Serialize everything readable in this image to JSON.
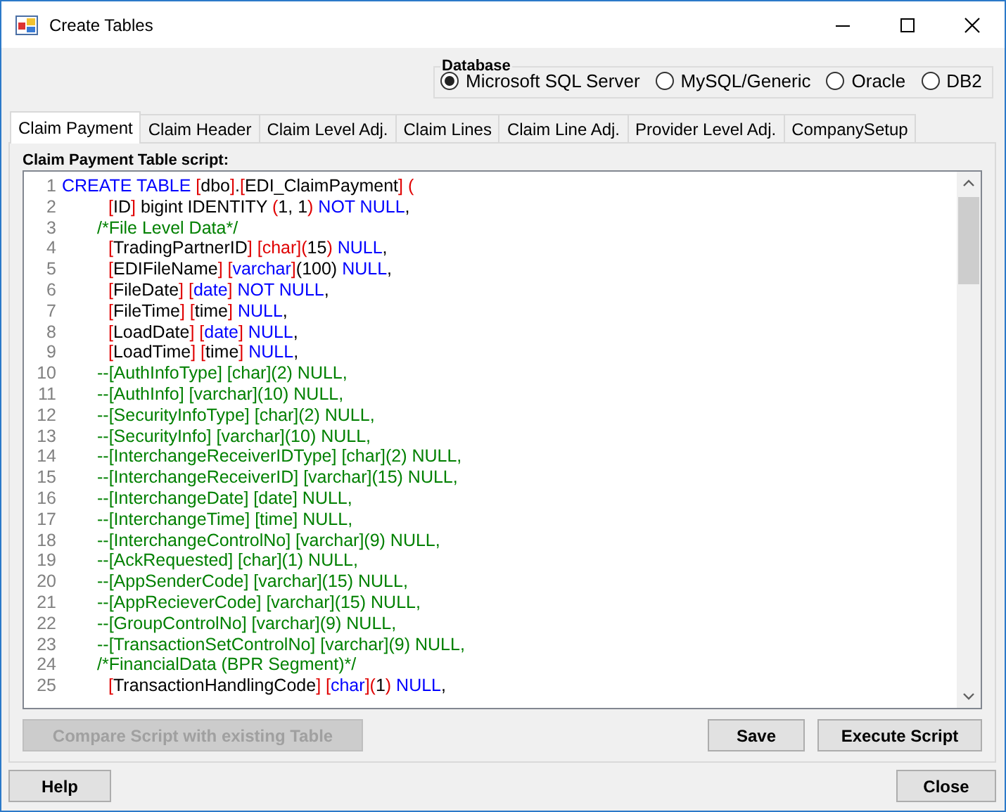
{
  "window": {
    "title": "Create Tables"
  },
  "database": {
    "label": "Database",
    "options": [
      {
        "label": "Microsoft SQL Server",
        "selected": true
      },
      {
        "label": "MySQL/Generic",
        "selected": false
      },
      {
        "label": "Oracle",
        "selected": false
      },
      {
        "label": "DB2",
        "selected": false
      }
    ]
  },
  "tabs": [
    {
      "label": "Claim Payment",
      "selected": true
    },
    {
      "label": "Claim Header",
      "selected": false
    },
    {
      "label": "Claim Level Adj.",
      "selected": false
    },
    {
      "label": "Claim Lines",
      "selected": false
    },
    {
      "label": "Claim Line Adj.",
      "selected": false
    },
    {
      "label": "Provider Level Adj.",
      "selected": false
    },
    {
      "label": "CompanySetup",
      "selected": false
    }
  ],
  "script_label": "Claim Payment Table script:",
  "editor": {
    "lines": [
      {
        "number": "1",
        "kind": "statement",
        "segments": [
          {
            "kind": "kw",
            "text": "CREATE TABLE "
          },
          {
            "kind": "br",
            "text": "["
          },
          {
            "kind": "tx",
            "text": "dbo"
          },
          {
            "kind": "br",
            "text": "]"
          },
          {
            "kind": "tx",
            "text": "."
          },
          {
            "kind": "br",
            "text": "["
          },
          {
            "kind": "tx",
            "text": "EDI_ClaimPayment"
          },
          {
            "kind": "br",
            "text": "] ("
          }
        ]
      },
      {
        "number": "2",
        "kind": "field",
        "segments": [
          {
            "kind": "br",
            "text": "["
          },
          {
            "kind": "tx",
            "text": "ID"
          },
          {
            "kind": "br",
            "text": "]"
          },
          {
            "kind": "tx",
            "text": " bigint IDENTITY "
          },
          {
            "kind": "br",
            "text": "("
          },
          {
            "kind": "tx",
            "text": "1, 1"
          },
          {
            "kind": "br",
            "text": ")"
          },
          {
            "kind": "kw",
            "text": " NOT NULL"
          },
          {
            "kind": "tx",
            "text": ","
          }
        ]
      },
      {
        "number": "3",
        "kind": "comment",
        "segments": [
          {
            "kind": "cm",
            "text": "/*File Level Data*/"
          }
        ]
      },
      {
        "number": "4",
        "kind": "field",
        "segments": [
          {
            "kind": "br",
            "text": "["
          },
          {
            "kind": "tx",
            "text": "TradingPartnerID"
          },
          {
            "kind": "br",
            "text": "] [char]("
          },
          {
            "kind": "tx",
            "text": "15"
          },
          {
            "kind": "br",
            "text": ")"
          },
          {
            "kind": "kw",
            "text": " NULL"
          },
          {
            "kind": "tx",
            "text": ","
          }
        ]
      },
      {
        "number": "5",
        "kind": "field",
        "segments": [
          {
            "kind": "br",
            "text": "["
          },
          {
            "kind": "tx",
            "text": "EDIFileName"
          },
          {
            "kind": "br",
            "text": "] ["
          },
          {
            "kind": "kw",
            "text": "varchar"
          },
          {
            "kind": "br",
            "text": "]"
          },
          {
            "kind": "tx",
            "text": "(100)"
          },
          {
            "kind": "kw",
            "text": " NULL"
          },
          {
            "kind": "tx",
            "text": ","
          }
        ]
      },
      {
        "number": "6",
        "kind": "field",
        "segments": [
          {
            "kind": "br",
            "text": "["
          },
          {
            "kind": "tx",
            "text": "FileDate"
          },
          {
            "kind": "br",
            "text": "] ["
          },
          {
            "kind": "kw",
            "text": "date"
          },
          {
            "kind": "br",
            "text": "]"
          },
          {
            "kind": "kw",
            "text": " NOT NULL"
          },
          {
            "kind": "tx",
            "text": ","
          }
        ]
      },
      {
        "number": "7",
        "kind": "field",
        "segments": [
          {
            "kind": "br",
            "text": "["
          },
          {
            "kind": "tx",
            "text": "FileTime"
          },
          {
            "kind": "br",
            "text": "] ["
          },
          {
            "kind": "tx",
            "text": "time"
          },
          {
            "kind": "br",
            "text": "]"
          },
          {
            "kind": "kw",
            "text": " NULL"
          },
          {
            "kind": "tx",
            "text": ","
          }
        ]
      },
      {
        "number": "8",
        "kind": "field",
        "segments": [
          {
            "kind": "br",
            "text": "["
          },
          {
            "kind": "tx",
            "text": "LoadDate"
          },
          {
            "kind": "br",
            "text": "] ["
          },
          {
            "kind": "kw",
            "text": "date"
          },
          {
            "kind": "br",
            "text": "]"
          },
          {
            "kind": "kw",
            "text": " NULL"
          },
          {
            "kind": "tx",
            "text": ","
          }
        ]
      },
      {
        "number": "9",
        "kind": "field",
        "segments": [
          {
            "kind": "br",
            "text": "["
          },
          {
            "kind": "tx",
            "text": "LoadTime"
          },
          {
            "kind": "br",
            "text": "] ["
          },
          {
            "kind": "tx",
            "text": "time"
          },
          {
            "kind": "br",
            "text": "]"
          },
          {
            "kind": "kw",
            "text": " NULL"
          },
          {
            "kind": "tx",
            "text": ","
          }
        ]
      },
      {
        "number": "10",
        "kind": "comment",
        "segments": [
          {
            "kind": "cm",
            "text": "--[AuthInfoType] [char](2) NULL,"
          }
        ]
      },
      {
        "number": "11",
        "kind": "comment",
        "segments": [
          {
            "kind": "cm",
            "text": "--[AuthInfo] [varchar](10) NULL,"
          }
        ]
      },
      {
        "number": "12",
        "kind": "comment",
        "segments": [
          {
            "kind": "cm",
            "text": "--[SecurityInfoType] [char](2) NULL,"
          }
        ]
      },
      {
        "number": "13",
        "kind": "comment",
        "segments": [
          {
            "kind": "cm",
            "text": "--[SecurityInfo] [varchar](10) NULL,"
          }
        ]
      },
      {
        "number": "14",
        "kind": "comment",
        "segments": [
          {
            "kind": "cm",
            "text": "--[InterchangeReceiverIDType] [char](2) NULL,"
          }
        ]
      },
      {
        "number": "15",
        "kind": "comment",
        "segments": [
          {
            "kind": "cm",
            "text": "--[InterchangeReceiverID] [varchar](15) NULL,"
          }
        ]
      },
      {
        "number": "16",
        "kind": "comment",
        "segments": [
          {
            "kind": "cm",
            "text": "--[InterchangeDate] [date] NULL,"
          }
        ]
      },
      {
        "number": "17",
        "kind": "comment",
        "segments": [
          {
            "kind": "cm",
            "text": "--[InterchangeTime] [time] NULL,"
          }
        ]
      },
      {
        "number": "18",
        "kind": "comment",
        "segments": [
          {
            "kind": "cm",
            "text": "--[InterchangeControlNo] [varchar](9) NULL,"
          }
        ]
      },
      {
        "number": "19",
        "kind": "comment",
        "segments": [
          {
            "kind": "cm",
            "text": "--[AckRequested] [char](1) NULL,"
          }
        ]
      },
      {
        "number": "20",
        "kind": "comment",
        "segments": [
          {
            "kind": "cm",
            "text": "--[AppSenderCode] [varchar](15) NULL,"
          }
        ]
      },
      {
        "number": "21",
        "kind": "comment",
        "segments": [
          {
            "kind": "cm",
            "text": "--[AppRecieverCode] [varchar](15) NULL,"
          }
        ]
      },
      {
        "number": "22",
        "kind": "comment",
        "segments": [
          {
            "kind": "cm",
            "text": "--[GroupControlNo] [varchar](9) NULL,"
          }
        ]
      },
      {
        "number": "23",
        "kind": "comment",
        "segments": [
          {
            "kind": "cm",
            "text": "--[TransactionSetControlNo] [varchar](9) NULL,"
          }
        ]
      },
      {
        "number": "24",
        "kind": "comment",
        "segments": [
          {
            "kind": "cm",
            "text": "/*FinancialData (BPR Segment)*/"
          }
        ]
      },
      {
        "number": "25",
        "kind": "field",
        "segments": [
          {
            "kind": "br",
            "text": "["
          },
          {
            "kind": "tx",
            "text": "TransactionHandlingCode"
          },
          {
            "kind": "br",
            "text": "] ["
          },
          {
            "kind": "kw",
            "text": "char"
          },
          {
            "kind": "br",
            "text": "]("
          },
          {
            "kind": "tx",
            "text": "1"
          },
          {
            "kind": "br",
            "text": ")"
          },
          {
            "kind": "kw",
            "text": " NULL"
          },
          {
            "kind": "tx",
            "text": ","
          }
        ]
      }
    ]
  },
  "panel_buttons": [
    {
      "label": "Compare Script with existing Table",
      "disabled": true
    },
    {
      "label": "Save",
      "disabled": false
    },
    {
      "label": "Execute Script",
      "disabled": false
    }
  ],
  "footer_buttons": [
    {
      "label": "Help"
    },
    {
      "label": "Close"
    }
  ]
}
